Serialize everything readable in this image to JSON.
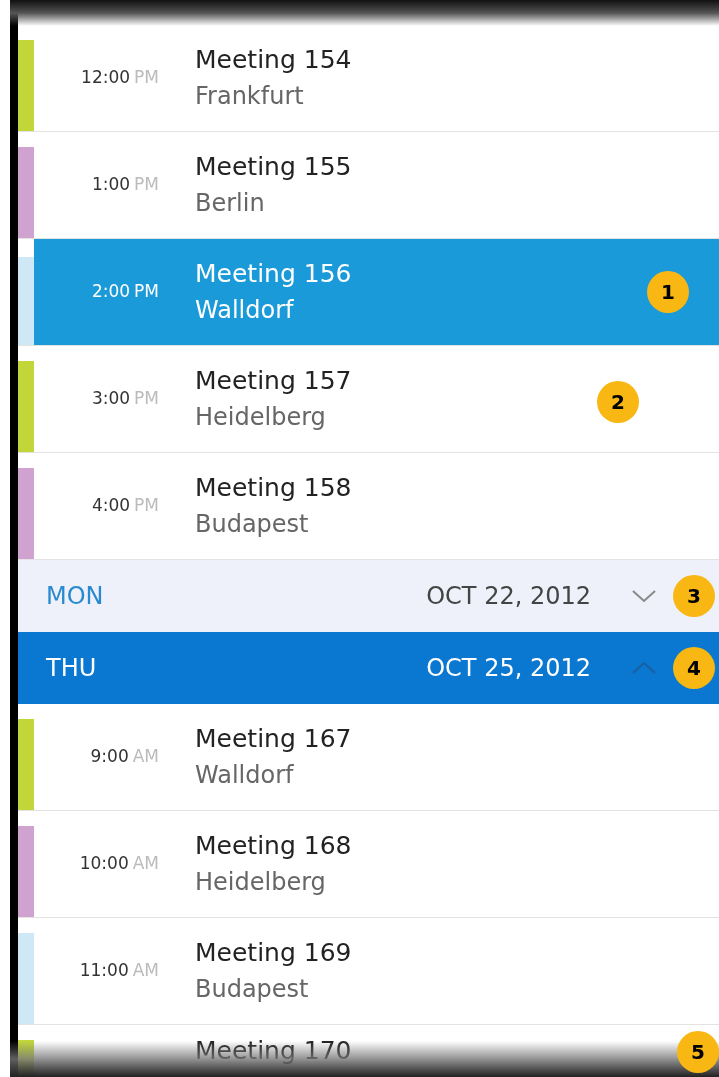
{
  "items": [
    {
      "kind": "event",
      "time": "12:00",
      "period": "PM",
      "title": "Meeting 154",
      "location": "Frankfurt",
      "color": "#c2d63a",
      "selected": false
    },
    {
      "kind": "event",
      "time": "1:00",
      "period": "PM",
      "title": "Meeting 155",
      "location": "Berlin",
      "color": "#d0a2cf",
      "selected": false
    },
    {
      "kind": "event",
      "time": "2:00",
      "period": "PM",
      "title": "Meeting 156",
      "location": "Walldorf",
      "color": "#cfe8f5",
      "selected": true,
      "callout": "1"
    },
    {
      "kind": "event",
      "time": "3:00",
      "period": "PM",
      "title": "Meeting 157",
      "location": "Heidelberg",
      "color": "#c2d63a",
      "selected": false,
      "callout": "2"
    },
    {
      "kind": "event",
      "time": "4:00",
      "period": "PM",
      "title": "Meeting 158",
      "location": "Budapest",
      "color": "#d0a2cf",
      "selected": false
    },
    {
      "kind": "day",
      "weekday": "MON",
      "date": "OCT 22, 2012",
      "expanded": false,
      "selected": false,
      "callout": "3"
    },
    {
      "kind": "day",
      "weekday": "THU",
      "date": "OCT 25, 2012",
      "expanded": true,
      "selected": true,
      "callout": "4"
    },
    {
      "kind": "event",
      "time": "9:00",
      "period": "AM",
      "title": "Meeting 167",
      "location": "Walldorf",
      "color": "#c2d63a",
      "selected": false
    },
    {
      "kind": "event",
      "time": "10:00",
      "period": "AM",
      "title": "Meeting 168",
      "location": "Heidelberg",
      "color": "#d0a2cf",
      "selected": false
    },
    {
      "kind": "event",
      "time": "11:00",
      "period": "AM",
      "title": "Meeting 169",
      "location": "Budapest",
      "color": "#cfe8f5",
      "selected": false
    },
    {
      "kind": "event_partial",
      "title": "Meeting 170",
      "color": "#c2d63a",
      "selected": false,
      "callout": "5"
    }
  ]
}
